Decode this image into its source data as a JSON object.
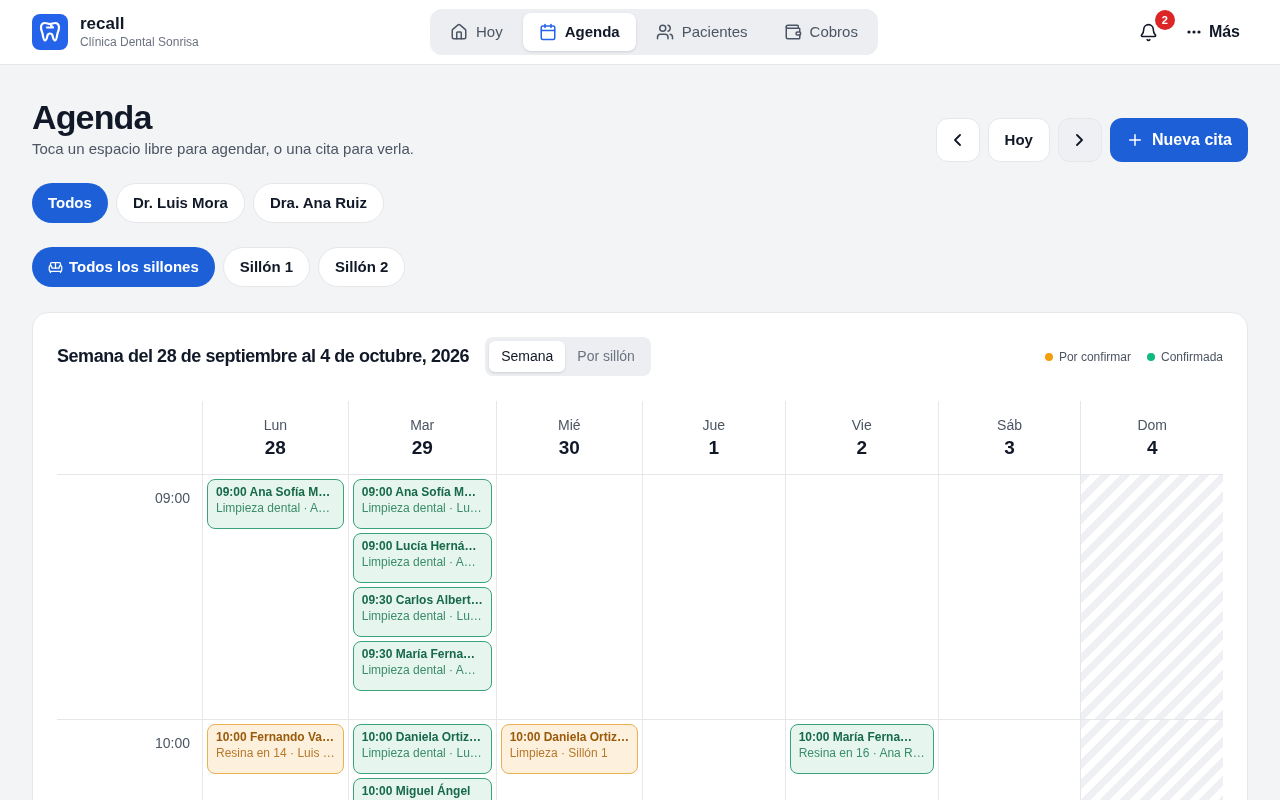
{
  "app": {
    "name": "recall",
    "subtitle": "Clínica Dental Sonrisa"
  },
  "nav": [
    {
      "label": "Hoy",
      "selected": false
    },
    {
      "label": "Agenda",
      "selected": true
    },
    {
      "label": "Pacientes",
      "selected": false
    },
    {
      "label": "Cobros",
      "selected": false
    }
  ],
  "notifications": {
    "count": "2"
  },
  "more": {
    "label": "Más"
  },
  "page": {
    "title": "Agenda",
    "subtitle": "Toca un espacio libre para agendar, o una cita para verla."
  },
  "toolbar": {
    "today": "Hoy",
    "new_appointment": "Nueva cita"
  },
  "dentist_filters": [
    {
      "label": "Todos",
      "selected": true
    },
    {
      "label": "Dr. Luis Mora",
      "selected": false
    },
    {
      "label": "Dra. Ana Ruiz",
      "selected": false
    }
  ],
  "chair_filters": [
    {
      "label": "Todos los sillones",
      "selected": true,
      "kind": "all"
    },
    {
      "label": "Sillón 1",
      "selected": false,
      "kind": "chair"
    },
    {
      "label": "Sillón 2",
      "selected": false,
      "kind": "chair"
    }
  ],
  "calendar": {
    "title": "Semana del 28 de septiembre al 4 de octubre, 2026",
    "views": [
      {
        "label": "Semana",
        "selected": true
      },
      {
        "label": "Por sillón",
        "selected": false
      }
    ],
    "legend": [
      {
        "label": "Por confirmar",
        "color": "#f59e0b"
      },
      {
        "label": "Confirmada",
        "color": "#10b981"
      }
    ],
    "days": [
      {
        "weekday": "Lun",
        "date": "28",
        "closed": false
      },
      {
        "weekday": "Mar",
        "date": "29",
        "closed": false
      },
      {
        "weekday": "Mié",
        "date": "30",
        "closed": false
      },
      {
        "weekday": "Jue",
        "date": "1",
        "closed": false
      },
      {
        "weekday": "Vie",
        "date": "2",
        "closed": false
      },
      {
        "weekday": "Sáb",
        "date": "3",
        "closed": false
      },
      {
        "weekday": "Dom",
        "date": "4",
        "closed": true
      }
    ],
    "hours": [
      {
        "time": "09:00",
        "slots": {
          "mon": [
            {
              "title": "09:00 Ana Sofía M…",
              "detail": "Limpieza dental · A…",
              "confirmed": true
            }
          ],
          "tue": [
            {
              "title": "09:00 Ana Sofía M…",
              "detail": "Limpieza dental · Lu…",
              "confirmed": true
            },
            {
              "title": "09:00 Lucía Herná…",
              "detail": "Limpieza dental · A…",
              "confirmed": true
            },
            {
              "title": "09:30 Carlos Albert…",
              "detail": "Limpieza dental · Lu…",
              "confirmed": true
            },
            {
              "title": "09:30 María Ferna…",
              "detail": "Limpieza dental · A…",
              "confirmed": true
            }
          ]
        }
      },
      {
        "time": "10:00",
        "slots": {
          "mon": [
            {
              "title": "10:00 Fernando Va…",
              "detail": "Resina en 14 · Luis …",
              "confirmed": false
            }
          ],
          "tue": [
            {
              "title": "10:00 Daniela Ortiz…",
              "detail": "Limpieza dental · Lu…",
              "confirmed": true
            },
            {
              "title": "10:00 Miguel Ángel",
              "confirmed": true
            }
          ],
          "wed": [
            {
              "title": "10:00 Daniela Ortiz…",
              "detail": "Limpieza · Sillón 1",
              "confirmed": false
            }
          ],
          "fri": [
            {
              "title": "10:00 María Ferna…",
              "detail": "Resina en 16 · Ana R…",
              "confirmed": true
            }
          ]
        }
      }
    ]
  }
}
